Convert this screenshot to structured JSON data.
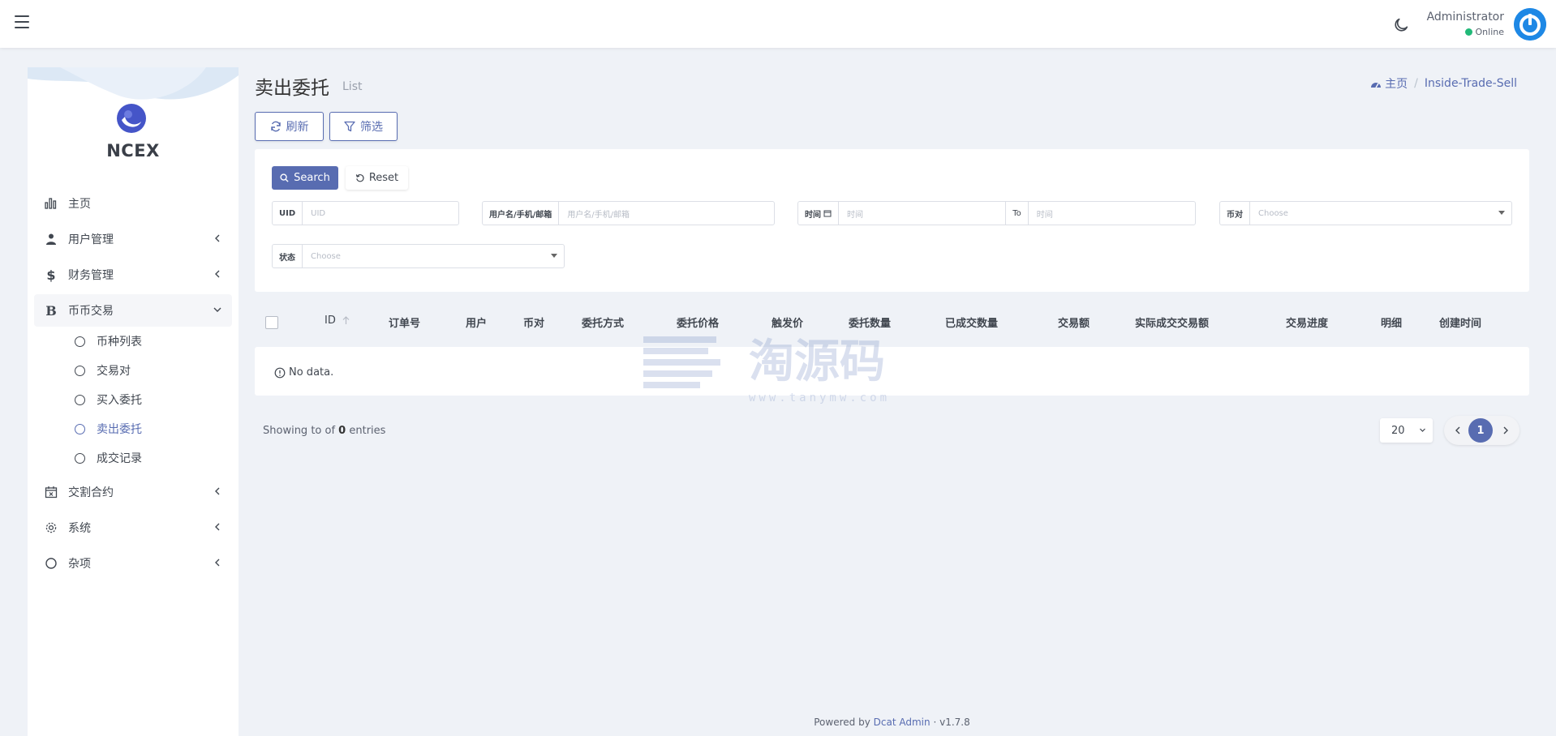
{
  "header": {
    "user_name": "Administrator",
    "user_status": "Online"
  },
  "sidebar": {
    "brand": "NCEX",
    "items": [
      {
        "label": "主页",
        "icon": "bar-chart-icon"
      },
      {
        "label": "用户管理",
        "icon": "users-icon"
      },
      {
        "label": "财务管理",
        "icon": "dollar-icon"
      },
      {
        "label": "币币交易",
        "icon": "bitcoin-icon",
        "expanded": true
      },
      {
        "label": "交割合约",
        "icon": "calendar-x-icon"
      },
      {
        "label": "系统",
        "icon": "gear-icon"
      },
      {
        "label": "杂项",
        "icon": "circle-icon"
      }
    ],
    "subitems": [
      {
        "label": "币种列表"
      },
      {
        "label": "交易对"
      },
      {
        "label": "买入委托"
      },
      {
        "label": "卖出委托",
        "active": true
      },
      {
        "label": "成交记录"
      }
    ]
  },
  "page": {
    "title": "卖出委托",
    "subtitle": "List",
    "breadcrumb_home": "主页",
    "breadcrumb_current": "Inside-Trade-Sell"
  },
  "toolbar": {
    "refresh_label": "刷新",
    "filter_label": "筛选"
  },
  "filter": {
    "search_label": "Search",
    "reset_label": "Reset",
    "uid_label": "UID",
    "uid_placeholder": "UID",
    "user_label": "用户名/手机/邮箱",
    "user_placeholder": "用户名/手机/邮箱",
    "time_label": "时间",
    "time_placeholder": "时间",
    "to_label": "To",
    "time_to_placeholder": "时间",
    "pair_label": "币对",
    "pair_value": "Choose",
    "status_label": "状态",
    "status_value": "Choose"
  },
  "table": {
    "columns": [
      "ID",
      "订单号",
      "用户",
      "币对",
      "委托方式",
      "委托价格",
      "触发价",
      "委托数量",
      "已成交数量",
      "交易额",
      "实际成交交易额",
      "交易进度",
      "明细",
      "创建时间"
    ],
    "empty_text": "No data."
  },
  "pagination": {
    "showing_prefix": "Showing to of",
    "total": "0",
    "showing_suffix": "entries",
    "per_page": "20",
    "current_page": "1"
  },
  "footer": {
    "prefix": "Powered by",
    "link": "Dcat Admin",
    "sep": "·",
    "version": "v1.7.8"
  },
  "watermark": {
    "text": "淘源码",
    "url": "www.tanymw.com"
  },
  "colors": {
    "primary": "#586cb1",
    "background": "#eff2f7",
    "online": "#21b978"
  }
}
